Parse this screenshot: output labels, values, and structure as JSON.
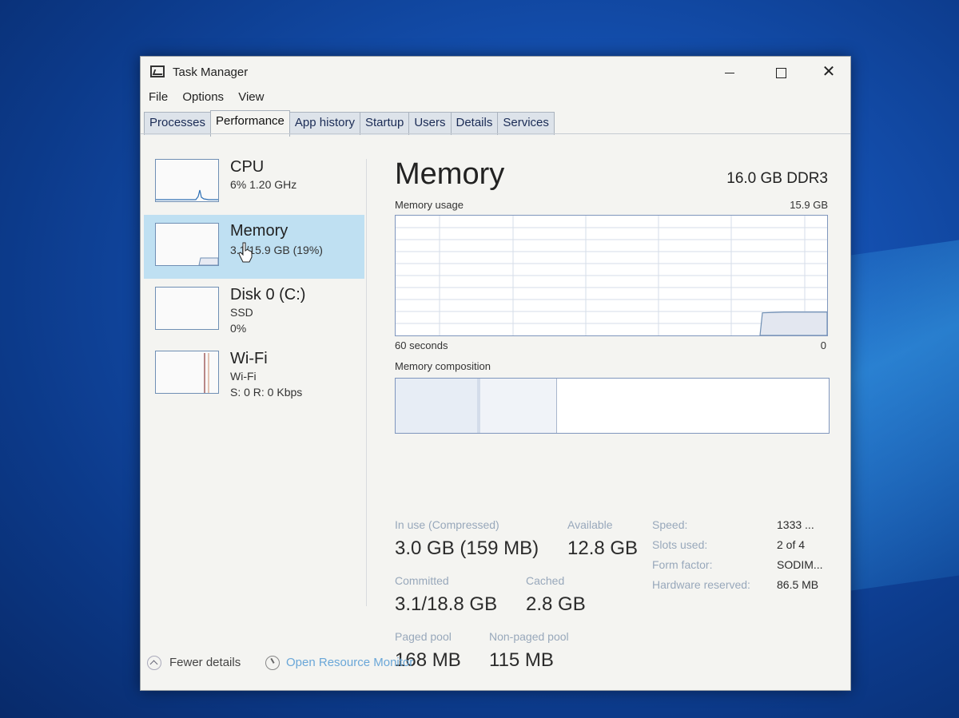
{
  "window": {
    "title": "Task Manager"
  },
  "menu": [
    "File",
    "Options",
    "View"
  ],
  "tabs": [
    "Processes",
    "Performance",
    "App history",
    "Startup",
    "Users",
    "Details",
    "Services"
  ],
  "active_tab": "Performance",
  "sidebar": [
    {
      "title": "CPU",
      "line1": "6%  1.20 GHz",
      "line2": ""
    },
    {
      "title": "Memory",
      "line1": "3.1/15.9 GB (19%)",
      "line2": ""
    },
    {
      "title": "Disk 0 (C:)",
      "line1": "SSD",
      "line2": "0%"
    },
    {
      "title": "Wi-Fi",
      "line1": "Wi-Fi",
      "line2": "S: 0 R: 0 Kbps"
    }
  ],
  "main": {
    "title": "Memory",
    "spec": "16.0 GB DDR3",
    "usage_label": "Memory usage",
    "usage_max": "15.9 GB",
    "axis_left": "60 seconds",
    "axis_right": "0",
    "composition_label": "Memory composition",
    "usage_series": {
      "x_seconds": [
        60,
        57,
        53,
        49,
        45,
        41,
        37,
        33,
        29,
        25,
        21,
        17,
        13,
        10,
        9,
        6,
        3,
        0
      ],
      "y_gb": [
        null,
        null,
        null,
        null,
        null,
        null,
        null,
        null,
        null,
        null,
        null,
        null,
        null,
        null,
        3.0,
        3.1,
        3.1,
        3.1
      ]
    },
    "composition": {
      "in_use": 3.0,
      "modified": 0.1,
      "standby": 2.8,
      "free": 10.0
    }
  },
  "stats": {
    "in_use_label": "In use (Compressed)",
    "in_use_value": "3.0 GB (159 MB)",
    "available_label": "Available",
    "available_value": "12.8 GB",
    "committed_label": "Committed",
    "committed_value": "3.1/18.8 GB",
    "cached_label": "Cached",
    "cached_value": "2.8 GB",
    "paged_label": "Paged pool",
    "paged_value": "168 MB",
    "nonpaged_label": "Non-paged pool",
    "nonpaged_value": "115 MB"
  },
  "specs": {
    "speed_label": "Speed:",
    "speed_value": "1333 ...",
    "slots_label": "Slots used:",
    "slots_value": "2 of 4",
    "form_label": "Form factor:",
    "form_value": "SODIM...",
    "hw_label": "Hardware reserved:",
    "hw_value": "86.5 MB"
  },
  "footer": {
    "fewer_details": "Fewer details",
    "open_resmon": "Open Resource Monitor"
  },
  "colors": {
    "accent_selected": "#bfe0f2",
    "graph_border": "#7f96bd",
    "link": "#6aa7d8"
  }
}
